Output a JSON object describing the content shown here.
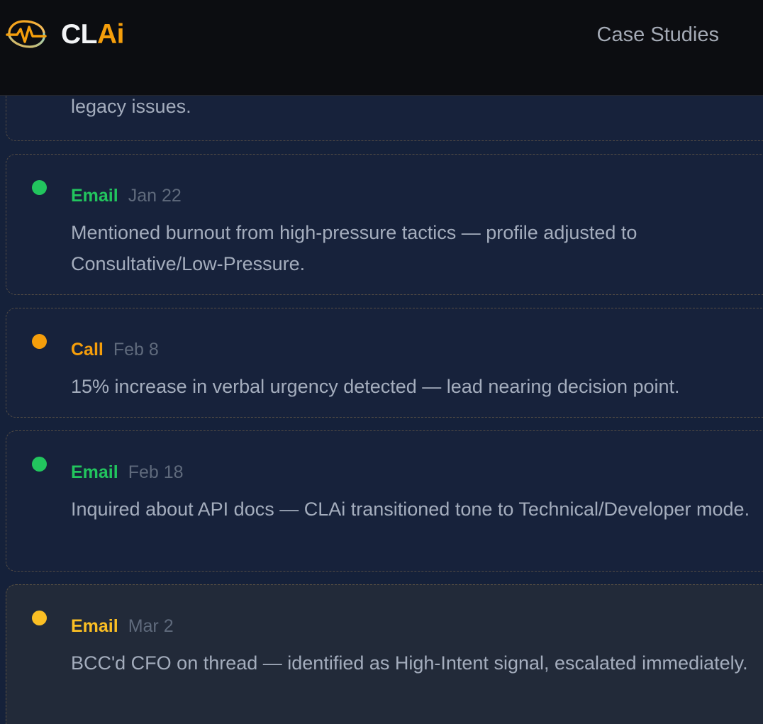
{
  "header": {
    "brand_prefix": "CL",
    "brand_suffix": "Ai",
    "nav_link": "Case Studies"
  },
  "colors": {
    "email": "#22c55e",
    "call": "#f59e0b",
    "highlight": "#fbbf24"
  },
  "timeline": {
    "previous_tail": "legacy issues.",
    "items": [
      {
        "type": "Email",
        "date": "Jan 22",
        "text": "Mentioned burnout from high-pressure tactics — profile adjusted to Consultative/Low-Pressure."
      },
      {
        "type": "Call",
        "date": "Feb 8",
        "text": "15% increase in verbal urgency detected — lead nearing decision point."
      },
      {
        "type": "Email",
        "date": "Feb 18",
        "text": "Inquired about API docs — CLAi transitioned tone to Technical/Developer mode."
      },
      {
        "type": "Email",
        "date": "Mar 2",
        "text": "BCC'd CFO on thread — identified as High-Intent signal, escalated immediately."
      }
    ]
  }
}
